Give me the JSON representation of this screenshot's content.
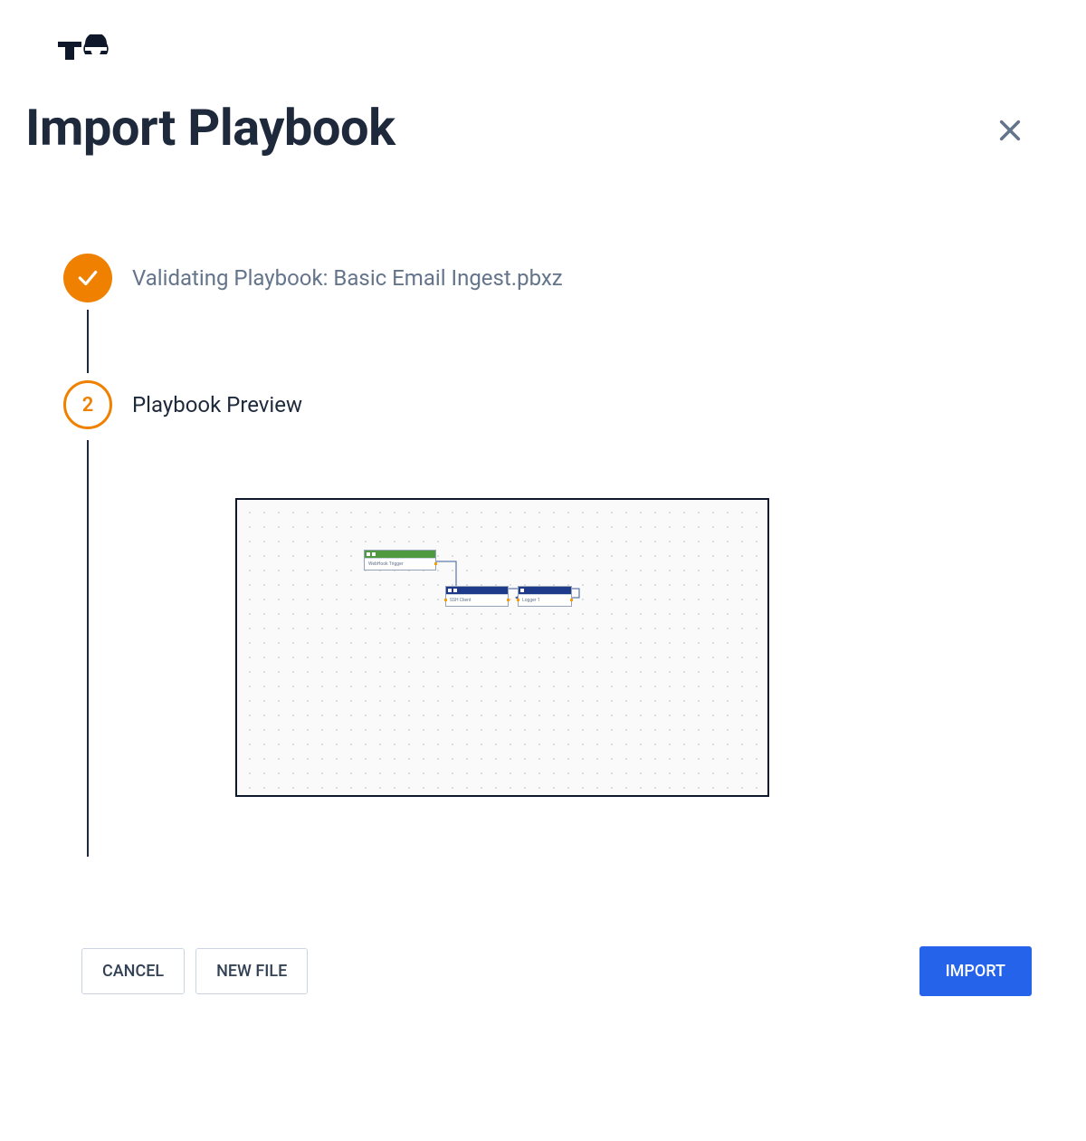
{
  "header": {
    "title": "Import Playbook"
  },
  "stepper": {
    "step1": {
      "label": "Validating Playbook: Basic Email Ingest.pbxz",
      "state": "complete"
    },
    "step2": {
      "number": "2",
      "label": "Playbook Preview",
      "state": "active"
    }
  },
  "preview": {
    "nodes": {
      "trigger": {
        "label": "WebHook Trigger"
      },
      "ssh": {
        "label": "SSH Client"
      },
      "logger": {
        "label": "Logger 1"
      }
    }
  },
  "footer": {
    "cancel": "CANCEL",
    "newFile": "NEW FILE",
    "import": "IMPORT"
  }
}
